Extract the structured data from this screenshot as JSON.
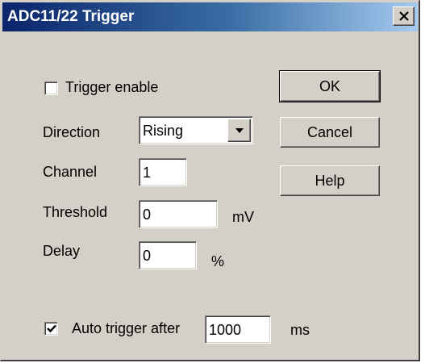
{
  "window": {
    "title": "ADC11/22 Trigger"
  },
  "titlebar": {
    "close_icon": "close-x-icon"
  },
  "trigger_enable": {
    "label": "Trigger enable",
    "checked": false
  },
  "direction": {
    "label": "Direction",
    "value": "Rising",
    "arrow_icon": "triangle-down-icon"
  },
  "channel": {
    "label": "Channel",
    "value": "1"
  },
  "threshold": {
    "label": "Threshold",
    "value": "0",
    "unit": "mV"
  },
  "delay": {
    "label": "Delay",
    "value": "0",
    "unit": "%"
  },
  "auto_trigger": {
    "label": "Auto trigger after",
    "checked": true,
    "value": "1000",
    "unit": "ms"
  },
  "buttons": {
    "ok": "OK",
    "cancel": "Cancel",
    "help": "Help"
  },
  "colors": {
    "title_start": "#0a246a",
    "title_end": "#a6caf0",
    "face": "#d4d0c8"
  }
}
